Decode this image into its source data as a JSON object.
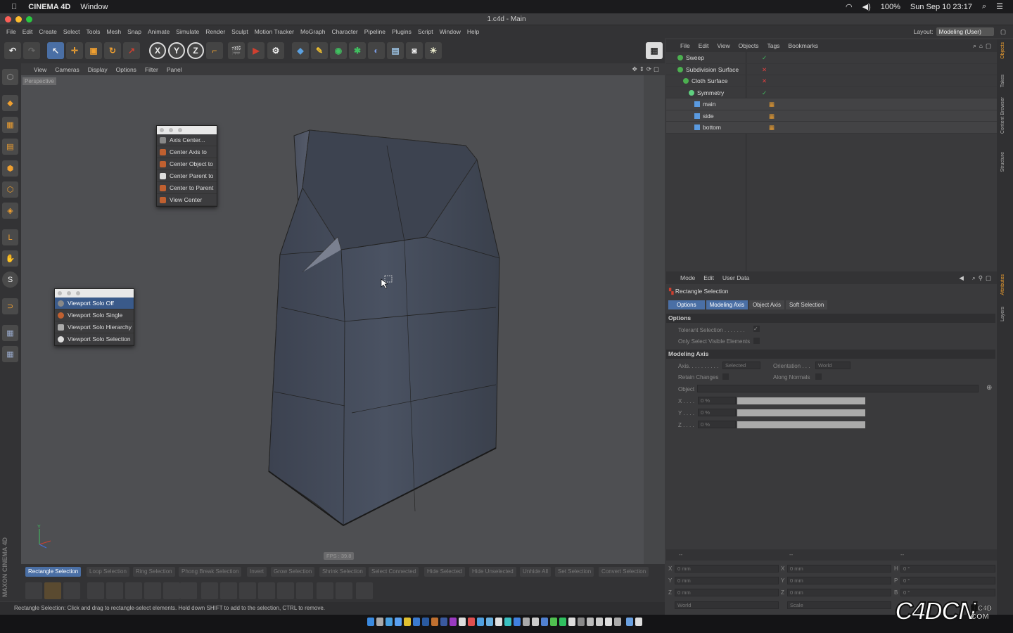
{
  "mac_menubar": {
    "app": "CINEMA 4D",
    "window_menu": "Window",
    "battery": "100%",
    "date_time": "Sun Sep 10  23:17"
  },
  "window": {
    "title": "1.c4d - Main"
  },
  "menu": [
    "File",
    "Edit",
    "Create",
    "Select",
    "Tools",
    "Mesh",
    "Snap",
    "Animate",
    "Simulate",
    "Render",
    "Sculpt",
    "Motion Tracker",
    "MoGraph",
    "Character",
    "Pipeline",
    "Plugins",
    "Script",
    "Window",
    "Help"
  ],
  "layout": {
    "label": "Layout:",
    "value": "Modeling (User)"
  },
  "viewport": {
    "menu": [
      "View",
      "Cameras",
      "Display",
      "Options",
      "Filter",
      "Panel"
    ],
    "name": "Perspective",
    "fps": "FPS : 39.8"
  },
  "axis_popup": {
    "items": [
      "Axis Center...",
      "Center Axis to",
      "Center Object to",
      "Center Parent to",
      "Center to Parent",
      "View Center"
    ]
  },
  "solo_popup": {
    "items": [
      "Viewport Solo Off",
      "Viewport Solo Single",
      "Viewport Solo Hierarchy",
      "Viewport Solo Selection"
    ]
  },
  "selection_bar": [
    "Rectangle Selection",
    "Loop Selection",
    "Ring Selection",
    "Phong Break Selection",
    "Invert",
    "Grow Selection",
    "Shrink Selection",
    "Select Connected",
    "Hide Selected",
    "Hide Unselected",
    "Unhide All",
    "Set Selection",
    "Convert Selection"
  ],
  "status": "Rectangle Selection: Click and drag to rectangle-select elements. Hold down SHIFT to add to the selection, CTRL to remove.",
  "objects_panel": {
    "menu": [
      "File",
      "Edit",
      "View",
      "Objects",
      "Tags",
      "Bookmarks"
    ],
    "objects": [
      {
        "name": "Sweep"
      },
      {
        "name": "Subdivision Surface"
      },
      {
        "name": "Cloth Surface"
      },
      {
        "name": "Symmetry"
      },
      {
        "name": "main"
      },
      {
        "name": "side"
      },
      {
        "name": "bottom"
      }
    ]
  },
  "attributes": {
    "menu": [
      "Mode",
      "Edit",
      "User Data"
    ],
    "tool_name": "Rectangle Selection",
    "tabs": [
      "Options",
      "Modeling Axis",
      "Object Axis",
      "Soft Selection"
    ],
    "options_header": "Options",
    "tolerant": "Tolerant Selection . . . . . . .",
    "only_visible": "Only Select Visible Elements",
    "axis_header": "Modeling Axis",
    "axis_label": "Axis. . . . . . . . . .",
    "axis_value": "Selected",
    "orientation_label": "Orientation . . .",
    "orientation_value": "World",
    "retain": "Retain Changes",
    "along_normals": "Along Normals",
    "object_label": "Object",
    "x_label": "X . . . .",
    "y_label": "Y . . . .",
    "z_label": "Z . . . .",
    "x_val": "0 %",
    "y_val": "0 %",
    "z_val": "0 %"
  },
  "coords": {
    "cols": [
      "--",
      "--",
      "--"
    ],
    "x": "0 mm",
    "y": "0 mm",
    "z": "0 mm",
    "hx": "0 mm",
    "hy": "0 mm",
    "hz": "0 mm",
    "h": "0 °",
    "p": "0 °",
    "b": "0 °",
    "world": "World",
    "scale": "Scale"
  },
  "side_tabs": [
    "Objects",
    "Takes",
    "Content Browser",
    "Structure",
    "Attributes",
    "Layers"
  ],
  "brand": "MAXON CINEMA 4D",
  "watermark": {
    "main": "C4DCN",
    "sub": "COM",
    "cn": "翻C4D"
  }
}
